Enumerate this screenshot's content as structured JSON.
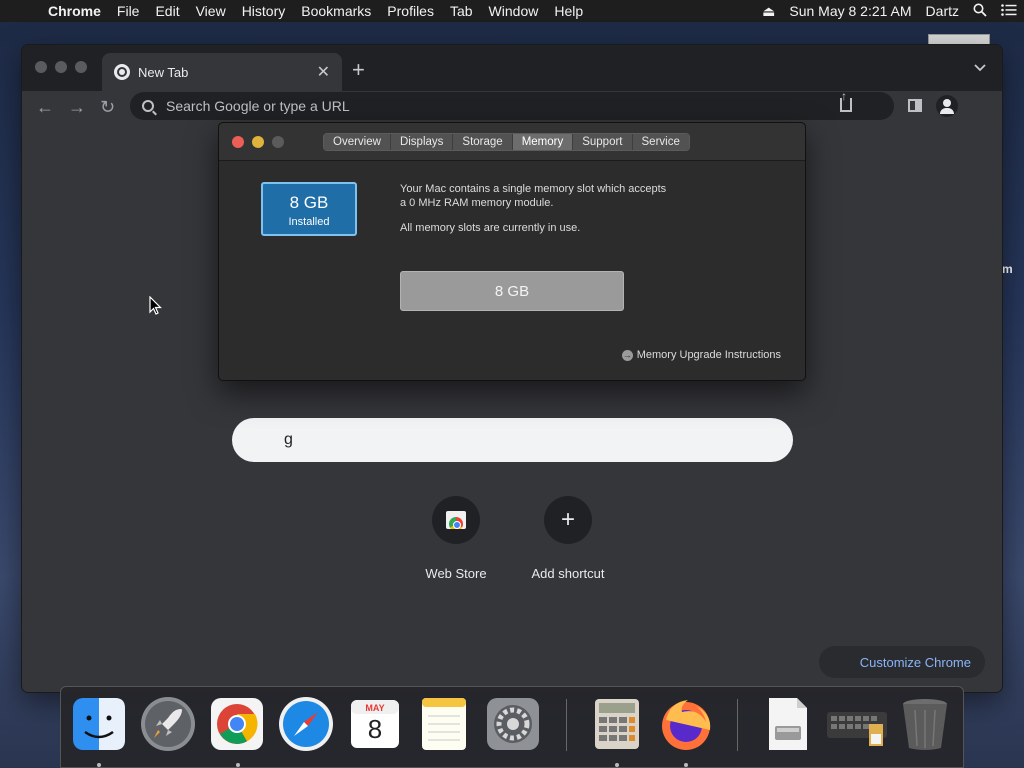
{
  "menubar": {
    "app_name": "Chrome",
    "items": [
      "File",
      "Edit",
      "View",
      "History",
      "Bookmarks",
      "Profiles",
      "Tab",
      "Window",
      "Help"
    ],
    "datetime": "Sun May 8  2:21 AM",
    "user": "Dartz"
  },
  "desktop": {
    "side_text": "m"
  },
  "chrome": {
    "tab_title": "New Tab",
    "omnibox_placeholder": "Search Google or type a URL",
    "ntp_search_value": "g",
    "shortcuts": [
      {
        "label": "Web Store",
        "icon": "web-store-icon"
      },
      {
        "label": "Add shortcut",
        "icon": "plus-icon"
      }
    ],
    "customize_label": "Customize Chrome"
  },
  "about_mac": {
    "tabs": [
      "Overview",
      "Displays",
      "Storage",
      "Memory",
      "Support",
      "Service"
    ],
    "active_tab": "Memory",
    "chip_size": "8 GB",
    "chip_label": "Installed",
    "desc_line1": "Your Mac contains a single memory slot which accepts",
    "desc_line2": "a 0 MHz RAM memory module.",
    "desc_status": "All memory slots are currently in use.",
    "slot_value": "8 GB",
    "upgrade_link": "Memory Upgrade Instructions"
  },
  "calendar": {
    "month": "MAY",
    "day": "8"
  },
  "dock": {
    "apps": [
      "Finder",
      "Launchpad",
      "Google Chrome",
      "Safari",
      "Calendar",
      "Notes",
      "System Preferences",
      "Calculator",
      "Firefox",
      "Disk Image",
      "Keyboard",
      "Trash"
    ]
  },
  "colors": {
    "memory_chip": "#1f6ea7",
    "close_light": "#ec5f57",
    "minimize_light": "#e0b33c",
    "link_blue": "#8ab4f8"
  }
}
